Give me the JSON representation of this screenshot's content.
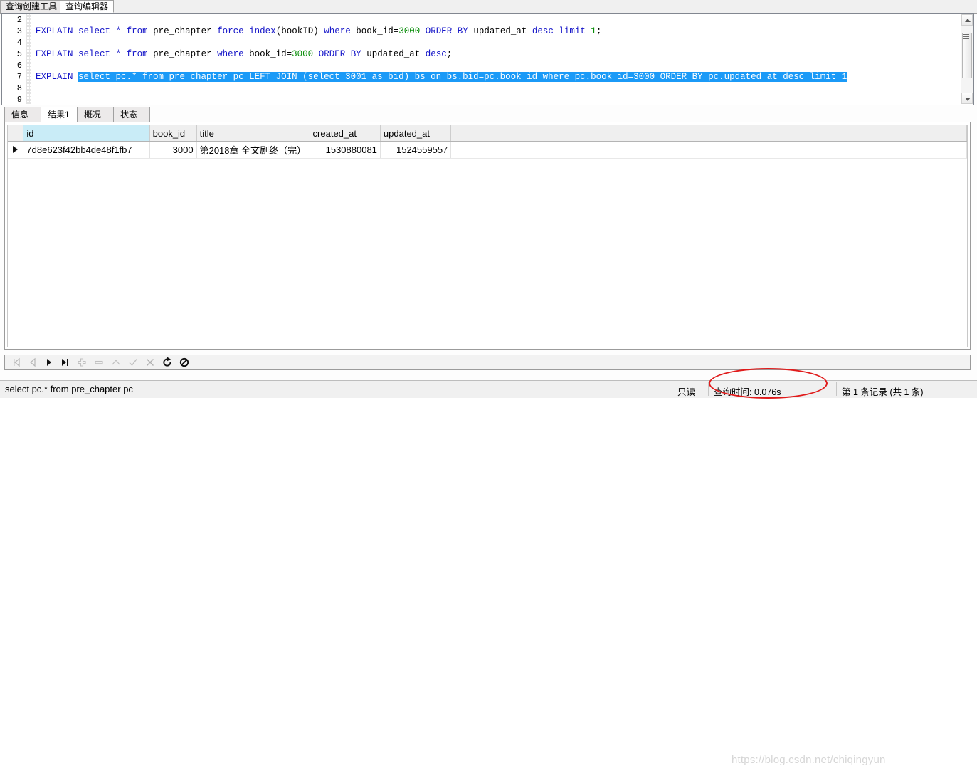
{
  "window": {
    "top_tabs": [
      {
        "label": "查询创建工具",
        "active": false
      },
      {
        "label": "查询编辑器",
        "active": true
      }
    ]
  },
  "editor": {
    "lines": [
      {
        "number": "2",
        "segments": []
      },
      {
        "number": "3",
        "segments": [
          {
            "t": "EXPLAIN",
            "c": "kw"
          },
          {
            "t": " ",
            "c": "id"
          },
          {
            "t": "select",
            "c": "kw"
          },
          {
            "t": " ",
            "c": "id"
          },
          {
            "t": "*",
            "c": "kw"
          },
          {
            "t": " ",
            "c": "id"
          },
          {
            "t": "from",
            "c": "kw"
          },
          {
            "t": " pre_chapter ",
            "c": "id"
          },
          {
            "t": "force",
            "c": "kw"
          },
          {
            "t": " ",
            "c": "id"
          },
          {
            "t": "index",
            "c": "kw"
          },
          {
            "t": "(bookID) ",
            "c": "id"
          },
          {
            "t": "where",
            "c": "kw"
          },
          {
            "t": " book_id=",
            "c": "id"
          },
          {
            "t": "3000",
            "c": "num"
          },
          {
            "t": " ",
            "c": "id"
          },
          {
            "t": "ORDER",
            "c": "kw"
          },
          {
            "t": " ",
            "c": "id"
          },
          {
            "t": "BY",
            "c": "kw"
          },
          {
            "t": " updated_at ",
            "c": "id"
          },
          {
            "t": "desc",
            "c": "kw"
          },
          {
            "t": " ",
            "c": "id"
          },
          {
            "t": "limit",
            "c": "kw"
          },
          {
            "t": " ",
            "c": "id"
          },
          {
            "t": "1",
            "c": "num"
          },
          {
            "t": ";",
            "c": "id"
          }
        ]
      },
      {
        "number": "4",
        "segments": []
      },
      {
        "number": "5",
        "segments": [
          {
            "t": "EXPLAIN",
            "c": "kw"
          },
          {
            "t": " ",
            "c": "id"
          },
          {
            "t": "select",
            "c": "kw"
          },
          {
            "t": " ",
            "c": "id"
          },
          {
            "t": "*",
            "c": "kw"
          },
          {
            "t": " ",
            "c": "id"
          },
          {
            "t": "from",
            "c": "kw"
          },
          {
            "t": " pre_chapter ",
            "c": "id"
          },
          {
            "t": "where",
            "c": "kw"
          },
          {
            "t": " book_id=",
            "c": "id"
          },
          {
            "t": "3000",
            "c": "num"
          },
          {
            "t": " ",
            "c": "id"
          },
          {
            "t": "ORDER",
            "c": "kw"
          },
          {
            "t": " ",
            "c": "id"
          },
          {
            "t": "BY",
            "c": "kw"
          },
          {
            "t": " updated_at ",
            "c": "id"
          },
          {
            "t": "desc",
            "c": "kw"
          },
          {
            "t": ";",
            "c": "id"
          }
        ]
      },
      {
        "number": "6",
        "segments": []
      },
      {
        "number": "7",
        "segments": [
          {
            "t": "EXPLAIN",
            "c": "kw"
          },
          {
            "t": " ",
            "c": "id"
          }
        ],
        "selected_text": "select pc.* from pre_chapter pc LEFT JOIN (select 3001 as bid) bs on bs.bid=pc.book_id where pc.book_id=3000 ORDER BY pc.updated_at desc limit 1"
      },
      {
        "number": "8",
        "segments": []
      },
      {
        "number": "9",
        "segments": []
      }
    ]
  },
  "results": {
    "tabs": [
      {
        "label": "信息",
        "active": false
      },
      {
        "label": "结果1",
        "active": true
      },
      {
        "label": "概况",
        "active": false
      },
      {
        "label": "状态",
        "active": false
      }
    ],
    "columns": [
      {
        "label": "id",
        "selected": true
      },
      {
        "label": "book_id",
        "selected": false
      },
      {
        "label": "title",
        "selected": false
      },
      {
        "label": "created_at",
        "selected": false
      },
      {
        "label": "updated_at",
        "selected": false
      }
    ],
    "rows": [
      {
        "id": "7d8e623f42bb4de48f1fb7",
        "book_id": "3000",
        "title": "第2018章 全文剧终（完）",
        "created_at": "1530880081",
        "updated_at": "1524559557"
      }
    ]
  },
  "navbar": {
    "buttons": [
      {
        "name": "first-record-icon",
        "title": "第一条记录"
      },
      {
        "name": "previous-record-icon",
        "title": "上一条记录"
      },
      {
        "name": "next-record-icon",
        "title": "下一条记录"
      },
      {
        "name": "last-record-icon",
        "title": "最后一条记录"
      },
      {
        "name": "add-record-icon",
        "title": "添加记录"
      },
      {
        "name": "delete-record-icon",
        "title": "删除记录"
      },
      {
        "name": "edit-record-icon",
        "title": "编辑记录"
      },
      {
        "name": "confirm-icon",
        "title": "应用改变"
      },
      {
        "name": "cancel-icon",
        "title": "放弃改变"
      },
      {
        "name": "refresh-icon",
        "title": "刷新"
      },
      {
        "name": "stop-icon",
        "title": "停止"
      }
    ]
  },
  "statusbar": {
    "sql": "select pc.* from pre_chapter pc",
    "readonly": "只读",
    "query_time": "查询时间: 0.076s",
    "record_count": "第 1 条记录 (共 1 条)"
  },
  "annotation": {
    "highlight_color": "#e01b1b",
    "watermark": "https://blog.csdn.net/chiqingyun"
  }
}
